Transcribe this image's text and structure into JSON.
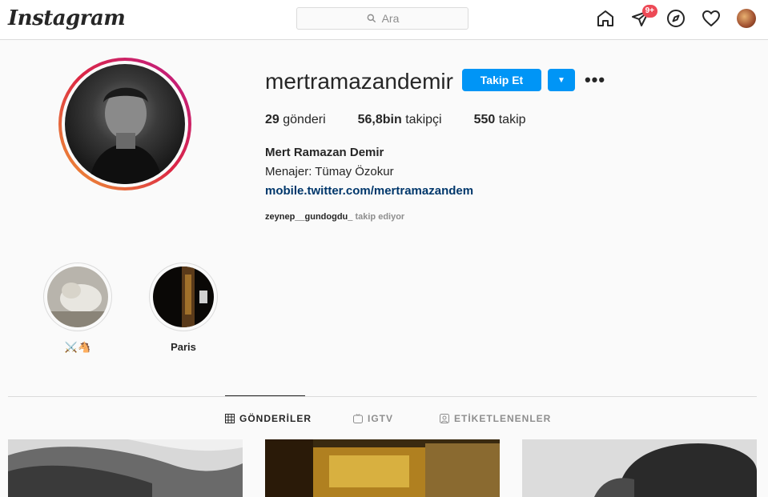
{
  "header": {
    "logo": "Instagram",
    "search_placeholder": "Ara",
    "notifications_badge": "9+"
  },
  "profile": {
    "username": "mertramazandemir",
    "follow_label": "Takip Et",
    "stats": {
      "posts_count": "29",
      "posts_label": "gönderi",
      "followers_count": "56,8bin",
      "followers_label": "takipçi",
      "following_count": "550",
      "following_label": "takip"
    },
    "full_name": "Mert Ramazan Demir",
    "bio": "Menajer: Tümay Özokur",
    "link": "mobile.twitter.com/mertramazandem",
    "followed_by_user": "zeynep__gundogdu_",
    "followed_by_text": "takip ediyor"
  },
  "highlights": [
    {
      "label": "⚔️🐴"
    },
    {
      "label": "Paris"
    }
  ],
  "tabs": [
    {
      "label": "GÖNDERİLER",
      "icon": "grid-icon",
      "active": true
    },
    {
      "label": "IGTV",
      "icon": "igtv-icon",
      "active": false
    },
    {
      "label": "ETİKETLENENLER",
      "icon": "tagged-icon",
      "active": false
    }
  ],
  "colors": {
    "accent": "#0095f6",
    "link": "#00376b",
    "badge": "#ed4956"
  }
}
